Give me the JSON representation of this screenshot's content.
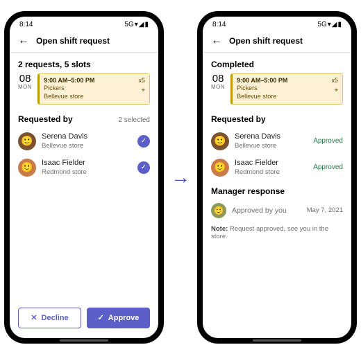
{
  "status": {
    "time": "8:14",
    "network": "5G",
    "icons": "▾◢▮"
  },
  "header": {
    "title": "Open shift request"
  },
  "left": {
    "summary": "2 requests, 5 slots",
    "date": {
      "num": "08",
      "dow": "MON"
    },
    "shift": {
      "time": "9:00 AM–5:00 PM",
      "role": "Pickers",
      "store": "Bellevue store",
      "count": "x5"
    },
    "requested_by_label": "Requested by",
    "selected_label": "2 selected",
    "people": [
      {
        "name": "Serena Davis",
        "store": "Bellevue store"
      },
      {
        "name": "Isaac Fielder",
        "store": "Redmond store"
      }
    ],
    "decline": "Decline",
    "approve": "Approve"
  },
  "right": {
    "summary": "Completed",
    "date": {
      "num": "08",
      "dow": "MON"
    },
    "shift": {
      "time": "9:00 AM–5:00 PM",
      "role": "Pickers",
      "store": "Bellevue store",
      "count": "x5"
    },
    "requested_by_label": "Requested by",
    "approved_label": "Approved",
    "people": [
      {
        "name": "Serena Davis",
        "store": "Bellevue store"
      },
      {
        "name": "Isaac Fielder",
        "store": "Redmond store"
      }
    ],
    "manager_label": "Manager response",
    "manager_status": "Approved by you",
    "manager_date": "May 7, 2021",
    "note_prefix": "Note:",
    "note_text": " Request approved, see you in the store."
  }
}
